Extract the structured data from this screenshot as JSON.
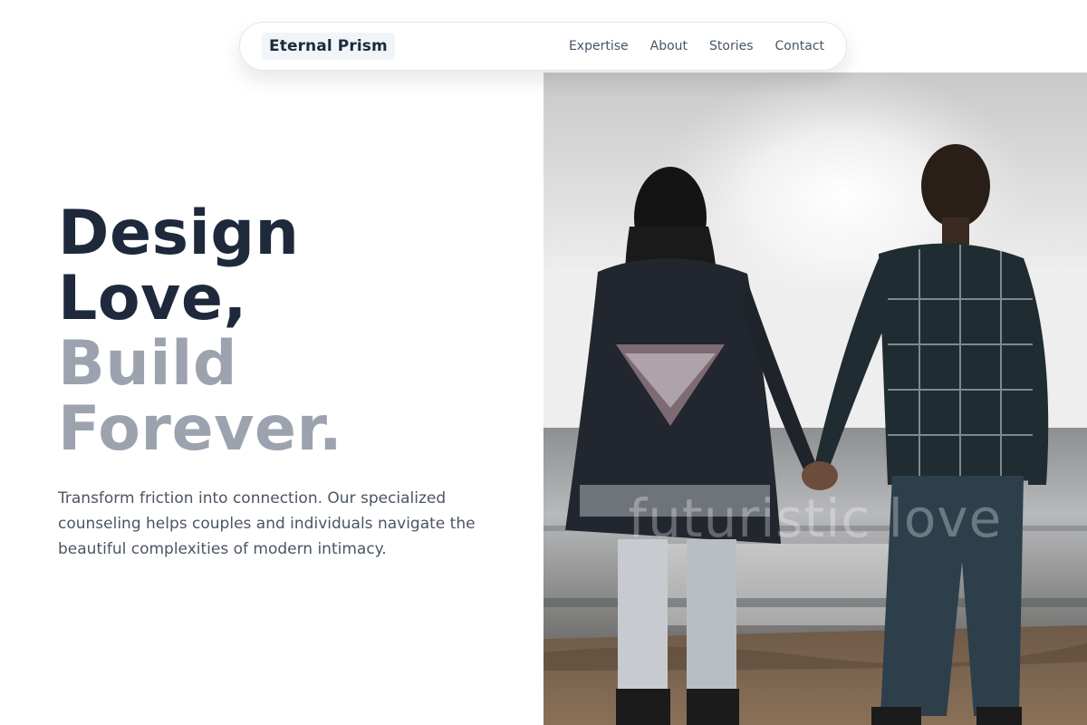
{
  "nav": {
    "brand": "Eternal Prism",
    "links": [
      "Expertise",
      "About",
      "Stories",
      "Contact"
    ]
  },
  "hero": {
    "title_lines": [
      "Design",
      "Love,",
      "Build",
      "Forever."
    ],
    "description": "Transform friction into connection. Our specialized counseling helps couples and individuals navigate the beautiful complexities of modern intimacy.",
    "image_overlay_text": "futuristic love"
  },
  "colors": {
    "title_dark": "#1e293b",
    "title_muted": "#9ca3af",
    "body_text": "#4b5563",
    "nav_text": "#475569"
  }
}
